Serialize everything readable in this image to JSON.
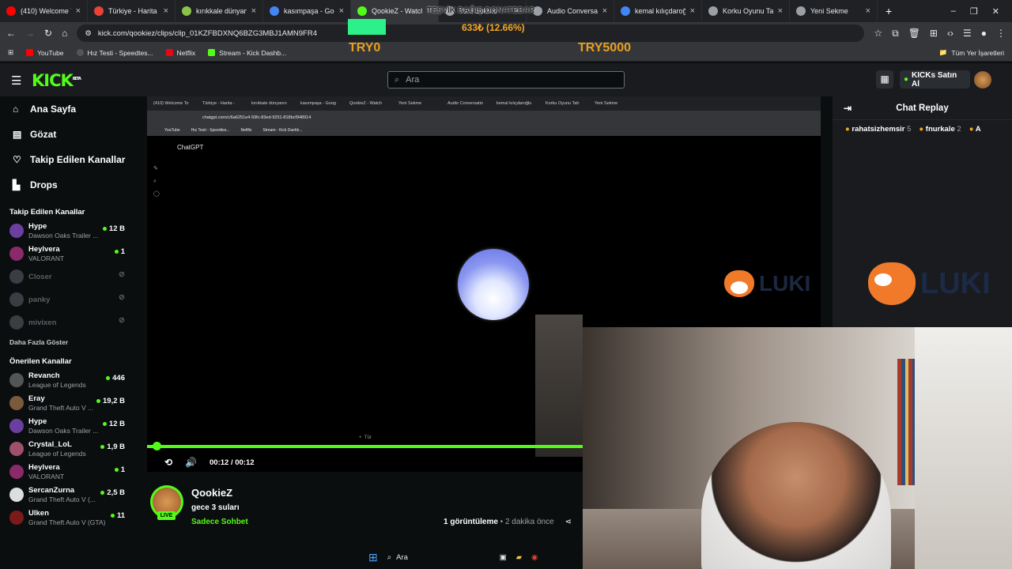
{
  "browser": {
    "tabs": [
      {
        "label": "(410) Welcome To",
        "color": "#ff0000"
      },
      {
        "label": "Türkiye - Harita -",
        "color": "#ea4335"
      },
      {
        "label": "kırıkkale dünyanın",
        "color": "#8bc34a"
      },
      {
        "label": "kasımpaşa - Goog",
        "color": "#4285f4"
      },
      {
        "label": "QookieZ - Watch",
        "color": "#53fc18"
      },
      {
        "label": "Yeni Sekme",
        "color": "#9aa0a6"
      },
      {
        "label": "Audio Conversatio",
        "color": "#9aa0a6"
      },
      {
        "label": "kemal kılıçdaroğlu",
        "color": "#4285f4"
      },
      {
        "label": "Korku Oyunu Tah",
        "color": "#9aa0a6"
      },
      {
        "label": "Yeni Sekme",
        "color": "#9aa0a6"
      }
    ],
    "url": "kick.com/qookiez/clips/clip_01KZFBDXNQ6BZG3MBJ1AMN9FR4",
    "bookmarks": [
      "YouTube",
      "Hız Testi - Speedtes...",
      "Netflix",
      "Stream - Kick Dashb..."
    ],
    "all_bookmarks": "Tüm Yer İşaretleri"
  },
  "overlay": {
    "donate": "TEŞVİK BAĞIŞ DONATEBAR",
    "pct": "633₺ (12.66%)",
    "min": "TRY0",
    "max": "TRY5000"
  },
  "kick": {
    "logo": "KICK",
    "beta": "BETA",
    "search_placeholder": "Ara",
    "buy_kicks": "KICKs Satın Al",
    "nav": [
      {
        "label": "Ana Sayfa",
        "icon": "home-icon"
      },
      {
        "label": "Gözat",
        "icon": "browse-icon"
      },
      {
        "label": "Takip Edilen Kanallar",
        "icon": "heart-icon"
      },
      {
        "label": "Drops",
        "icon": "drops-icon"
      }
    ],
    "followed_title": "Takip Edilen Kanallar",
    "followed": [
      {
        "name": "Hype",
        "game": "Dawson Oaks Trailer ...",
        "viewers": "12 B",
        "online": true,
        "color": "#6b3fa0"
      },
      {
        "name": "Heylvera",
        "game": "VALORANT",
        "viewers": "1",
        "online": true,
        "color": "#8a2a6a"
      },
      {
        "name": "Closer",
        "game": "",
        "viewers": "",
        "online": false,
        "color": "#3a3d41"
      },
      {
        "name": "panky",
        "game": "",
        "viewers": "",
        "online": false,
        "color": "#3a3d41"
      },
      {
        "name": "mivixen",
        "game": "",
        "viewers": "",
        "online": false,
        "color": "#3a3d41"
      }
    ],
    "show_more": "Daha Fazla Göster",
    "recommended_title": "Önerilen Kanallar",
    "recommended": [
      {
        "name": "Revanch",
        "game": "League of Legends",
        "viewers": "446",
        "color": "#555"
      },
      {
        "name": "Eray",
        "game": "Grand Theft Auto V ...",
        "viewers": "19,2 B",
        "color": "#7a5a3a"
      },
      {
        "name": "Hype",
        "game": "Dawson Oaks Trailer ...",
        "viewers": "12 B",
        "color": "#6b3fa0"
      },
      {
        "name": "Crystal_LoL",
        "game": "League of Legends",
        "viewers": "1,9 B",
        "color": "#a0506a"
      },
      {
        "name": "Heylvera",
        "game": "VALORANT",
        "viewers": "1",
        "color": "#8a2a6a"
      },
      {
        "name": "SercanZurna",
        "game": "Grand Theft Auto V (...",
        "viewers": "2,5 B",
        "color": "#ddd"
      },
      {
        "name": "Ulken",
        "game": "Grand Theft Auto V (GTA)",
        "viewers": "11",
        "color": "#7a1a1a"
      }
    ],
    "player": {
      "time": "00:12 / 00:12",
      "progress": 1.0,
      "inner_app": "ChatGPT",
      "inner_url": "chatgpt.com/c/6a6251e4-59fc-83ed-9251-818bcf948914",
      "inner_placeholder": "Tür"
    },
    "stream": {
      "channel": "QookieZ",
      "title": "gece 3 suları",
      "category": "Sadece Sohbet",
      "views_count": "1",
      "views_label": "görüntüleme",
      "ago": "2 dakika önce",
      "live": "LIVE"
    },
    "chat": {
      "title": "Chat Replay",
      "gifters": [
        {
          "name": "rahatsizhemsir",
          "n": "5"
        },
        {
          "name": "fnurkale",
          "n": "2"
        },
        {
          "name": "A",
          "n": ""
        }
      ],
      "brand": "LUKI"
    },
    "taskbar_search": "Ara"
  }
}
